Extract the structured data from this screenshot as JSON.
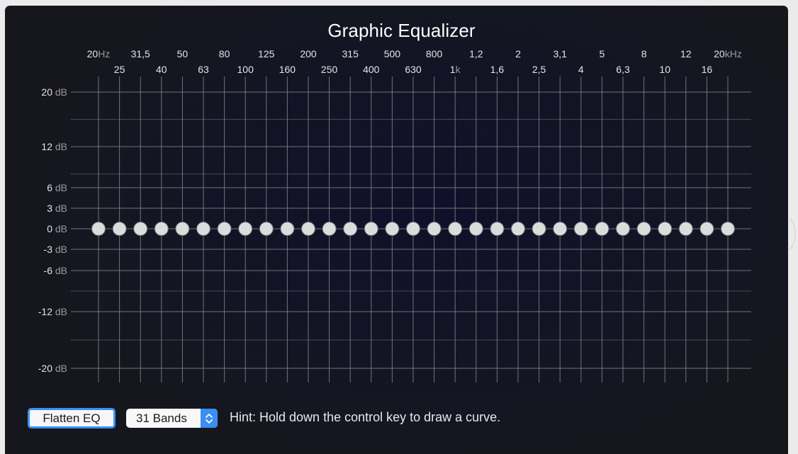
{
  "window": {
    "title": "Graphic Equalizer"
  },
  "eq": {
    "top_labels": [
      {
        "num": "20",
        "unit": "Hz"
      },
      {
        "num": "31,5",
        "unit": ""
      },
      {
        "num": "50",
        "unit": ""
      },
      {
        "num": "80",
        "unit": ""
      },
      {
        "num": "125",
        "unit": ""
      },
      {
        "num": "200",
        "unit": ""
      },
      {
        "num": "315",
        "unit": ""
      },
      {
        "num": "500",
        "unit": ""
      },
      {
        "num": "800",
        "unit": ""
      },
      {
        "num": "1,2",
        "unit": ""
      },
      {
        "num": "2",
        "unit": ""
      },
      {
        "num": "3,1",
        "unit": ""
      },
      {
        "num": "5",
        "unit": ""
      },
      {
        "num": "8",
        "unit": ""
      },
      {
        "num": "12",
        "unit": ""
      },
      {
        "num": "20",
        "unit": "kHz"
      }
    ],
    "bottom_labels": [
      {
        "num": "25",
        "unit": ""
      },
      {
        "num": "40",
        "unit": ""
      },
      {
        "num": "63",
        "unit": ""
      },
      {
        "num": "100",
        "unit": ""
      },
      {
        "num": "160",
        "unit": ""
      },
      {
        "num": "250",
        "unit": ""
      },
      {
        "num": "400",
        "unit": ""
      },
      {
        "num": "630",
        "unit": ""
      },
      {
        "num": "1",
        "unit": "k"
      },
      {
        "num": "1,6",
        "unit": ""
      },
      {
        "num": "2,5",
        "unit": ""
      },
      {
        "num": "4",
        "unit": ""
      },
      {
        "num": "6,3",
        "unit": ""
      },
      {
        "num": "10",
        "unit": ""
      },
      {
        "num": "16",
        "unit": ""
      }
    ],
    "db_labels": [
      {
        "db": 20,
        "num": "20",
        "unit": "dB"
      },
      {
        "db": 12,
        "num": "12",
        "unit": "dB"
      },
      {
        "db": 6,
        "num": "6",
        "unit": "dB"
      },
      {
        "db": 3,
        "num": "3",
        "unit": "dB"
      },
      {
        "db": 0,
        "num": "0",
        "unit": "dB"
      },
      {
        "db": -3,
        "num": "-3",
        "unit": "dB"
      },
      {
        "db": -6,
        "num": "-6",
        "unit": "dB"
      },
      {
        "db": -12,
        "num": "-12",
        "unit": "dB"
      },
      {
        "db": -20,
        "num": "-20",
        "unit": "dB"
      }
    ],
    "band_gains_db": [
      0,
      0,
      0,
      0,
      0,
      0,
      0,
      0,
      0,
      0,
      0,
      0,
      0,
      0,
      0,
      0,
      0,
      0,
      0,
      0,
      0,
      0,
      0,
      0,
      0,
      0,
      0,
      0,
      0,
      0,
      0
    ],
    "colors": {
      "grid": "#8a8a90",
      "knob": "#dcdcdc",
      "knob_border": "#6a6a6a"
    }
  },
  "controls": {
    "flatten_label": "Flatten EQ",
    "bands_selected": "31 Bands",
    "hint": "Hint: Hold down the control key to draw a curve."
  },
  "colors": {
    "accent": "#3b8ef4",
    "panel_bg": "#14151f",
    "text": "#e8e8e8"
  }
}
